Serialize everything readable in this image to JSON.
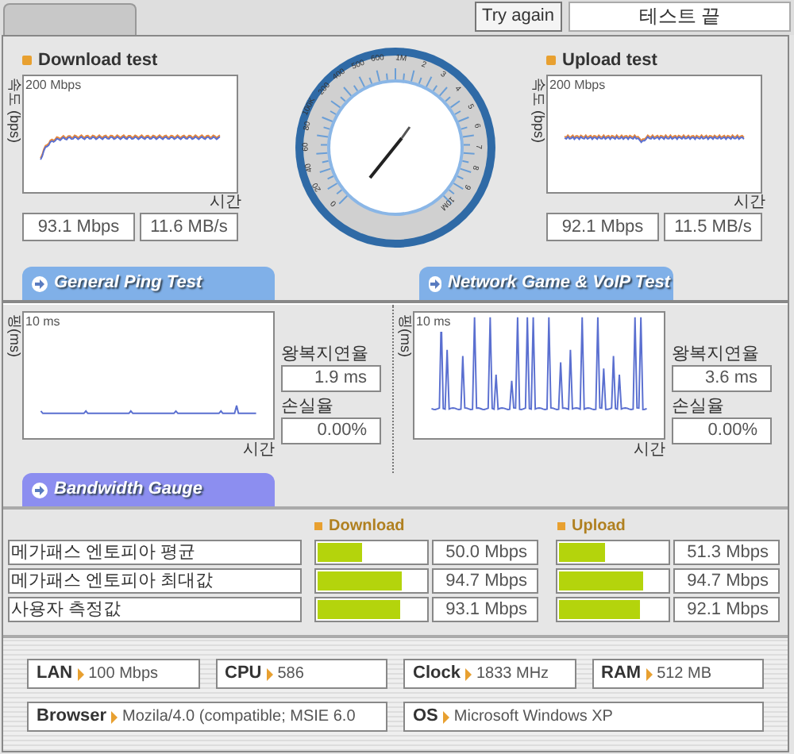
{
  "top_bar": {
    "try_again_button": "Try again",
    "status_field": "테스트 끝"
  },
  "download_test": {
    "title": "Download test",
    "y_axis": "속도 (bps)",
    "y_max": "200 Mbps",
    "x_axis": "시간",
    "readings": [
      "93.1 Mbps",
      "11.6 MB/s"
    ]
  },
  "gauge": {
    "labels": [
      "0",
      "20",
      "40",
      "60",
      "80",
      "100K",
      "200",
      "400",
      "500",
      "600",
      "1M",
      "2",
      "3",
      "4",
      "5",
      "6",
      "7",
      "8",
      "9",
      "10M"
    ]
  },
  "upload_test": {
    "title": "Upload test",
    "y_axis": "속도 (bps)",
    "y_max": "200 Mbps",
    "x_axis": "시간",
    "readings": [
      "92.1 Mbps",
      "11.5 MB/s"
    ]
  },
  "ping_tabs": [
    {
      "label": "General Ping Test",
      "kind": "ping"
    },
    {
      "label": "Network Game & VoIP Test",
      "kind": "game"
    }
  ],
  "ping_panels": [
    {
      "kind": "flat",
      "y_axis": "핑(ms)",
      "y_max": "10 ms",
      "x_axis": "시간",
      "latency_label": "왕복지연율",
      "latency": "1.9 ms",
      "loss_label": "손실율",
      "loss": "0.00%"
    },
    {
      "kind": "spiky",
      "y_axis": "핑(ms)",
      "y_max": "10 ms",
      "x_axis": "시간",
      "latency_label": "왕복지연율",
      "latency": "3.6 ms",
      "loss_label": "손실율",
      "loss": "0.00%"
    }
  ],
  "bandwidth": {
    "tab": "Bandwidth Gauge",
    "download_header": "Download",
    "upload_header": "Upload",
    "rows": [
      {
        "label": "메가패스 엔토피아 평균",
        "download": {
          "level": 0.41,
          "reading": "50.0 Mbps"
        },
        "upload": {
          "level": 0.42,
          "reading": "51.3 Mbps"
        }
      },
      {
        "label": "메가패스 엔토피아 최대값",
        "download": {
          "level": 0.78,
          "reading": "94.7 Mbps"
        },
        "upload": {
          "level": 0.78,
          "reading": "94.7 Mbps"
        }
      },
      {
        "label": "사용자 측정값",
        "download": {
          "level": 0.76,
          "reading": "93.1 Mbps"
        },
        "upload": {
          "level": 0.75,
          "reading": "92.1 Mbps"
        }
      }
    ]
  },
  "system_info": [
    {
      "label": "LAN",
      "value": "100 Mbps"
    },
    {
      "label": "CPU",
      "value": "586"
    },
    {
      "label": "Clock",
      "value": "1833 MHz"
    },
    {
      "label": "RAM",
      "value": "512 MB"
    },
    {
      "label": "Browser",
      "value": "Mozila/4.0 (compatible; MSIE 6.0"
    },
    {
      "label": "OS",
      "value": "Microsoft Windows XP"
    }
  ]
}
